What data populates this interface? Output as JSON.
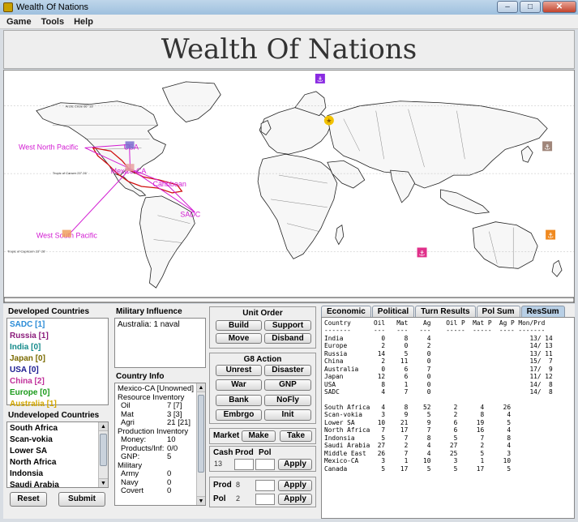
{
  "window": {
    "title": "Wealth Of Nations",
    "minimize": "–",
    "maximize": "□",
    "close": "✕"
  },
  "menu": [
    "Game",
    "Tools",
    "Help"
  ],
  "header": {
    "title": "Wealth Of Nations"
  },
  "map": {
    "labels": {
      "west_north_pacific": "West North Pacific",
      "usa": "USA",
      "mexico_ca": "Mexico-CA",
      "caribbean": "Caribbean",
      "sadc": "SADC",
      "west_south_pacific": "West South Pacific"
    },
    "latitude_lines": {
      "arctic": "Arctic Circle 66° 33'",
      "cancer": "Tropic of Cancer 23° 26'",
      "capricorn": "Tropic of Capricorn 23° 26'"
    },
    "icons": [
      "anchor-purple",
      "star-gold",
      "anchor-brown",
      "anchor-pink",
      "anchor-orange",
      "ship-usa",
      "ship-mexico",
      "ship-wsp"
    ],
    "route_color": "#d21bd2"
  },
  "developed": {
    "title": "Developed Countries",
    "items": [
      {
        "label": "SADC [1]",
        "color": "#2a8bd6"
      },
      {
        "label": "Russia [1]",
        "color": "#8a1a7a"
      },
      {
        "label": "India [0]",
        "color": "#138a8a"
      },
      {
        "label": "Japan [0]",
        "color": "#7a6a00"
      },
      {
        "label": "USA [0]",
        "color": "#1a1a90"
      },
      {
        "label": "China [2]",
        "color": "#c0309a"
      },
      {
        "label": "Europe [0]",
        "color": "#1a9a1a"
      },
      {
        "label": "Australia [1]",
        "color": "#d4a800"
      }
    ]
  },
  "undeveloped": {
    "title": "Undeveloped Countries",
    "items": [
      "South Africa",
      "Scan-vokia",
      "Lower SA",
      "North Africa",
      "Indonsia",
      "Saudi Arabia"
    ],
    "scroll_up": "▲",
    "scroll_down": "▼"
  },
  "buttons": {
    "reset": "Reset",
    "submit": "Submit"
  },
  "military_influence": {
    "title": "Military Influence",
    "text": "Australia: 1 naval"
  },
  "country_info": {
    "title": "Country Info",
    "rows": [
      {
        "label": "Mexico-CA [Unowned]",
        "value": "",
        "indent": false
      },
      {
        "label": "Resource Inventory",
        "value": "",
        "indent": false
      },
      {
        "label": "Oil",
        "value": "7 [7]",
        "indent": true
      },
      {
        "label": "Mat",
        "value": "3 [3]",
        "indent": true
      },
      {
        "label": "Agri",
        "value": "21 [21]",
        "indent": true
      },
      {
        "label": "Production Inventory",
        "value": "",
        "indent": false
      },
      {
        "label": "Money:",
        "value": "10",
        "indent": true
      },
      {
        "label": "Products/Inf:",
        "value": "0/0",
        "indent": true
      },
      {
        "label": "GNP:",
        "value": "5",
        "indent": true
      },
      {
        "label": "Military",
        "value": "",
        "indent": false
      },
      {
        "label": "Army",
        "value": "0",
        "indent": true
      },
      {
        "label": "Navy",
        "value": "0",
        "indent": true
      },
      {
        "label": "Covert",
        "value": "0",
        "indent": true
      }
    ]
  },
  "unit_order": {
    "title": "Unit Order",
    "build": "Build",
    "support": "Support",
    "move": "Move",
    "disband": "Disband"
  },
  "g8": {
    "title": "G8 Action",
    "unrest": "Unrest",
    "disaster": "Disaster",
    "war": "War",
    "gnp": "GNP",
    "bank": "Bank",
    "nofly": "NoFly",
    "embrgo": "Embrgo",
    "init": "Init"
  },
  "market": {
    "label": "Market",
    "make": "Make",
    "take": "Take"
  },
  "cash_prod_pol": {
    "cash": "Cash",
    "prod": "Prod",
    "pol": "Pol",
    "cash_value": "13",
    "apply": "Apply"
  },
  "prod_pol": {
    "prod": "Prod",
    "prod_value": "8",
    "pol": "Pol",
    "pol_value": "2",
    "apply": "Apply"
  },
  "tabs": [
    "Economic",
    "Political",
    "Turn Results",
    "Pol Sum",
    "ResSum"
  ],
  "ressum": {
    "text": "Country      Oil   Mat    Ag    Oil P  Mat P  Ag P Mon/Prd\n-------      ---   ---   ---    -----  -----  ---- -------\nIndia          0     8     4                          13/ 14\nEurope         2     0     2                          14/ 13\nRussia        14     5     0                          13/ 11\nChina          2    11     0                          15/  7\nAustralia      0     6     7                          17/  9\nJapan         12     6     0                          11/ 12\nUSA            8     1     0                          14/  8\nSADC           4     7     0                          14/  8\n\nSouth Africa   4     8    52      2      4     26\nScan-vokia     3     9     5      2      8      4\nLower SA      10    21     9      6     19      5\nNorth Africa   7    17     7      6     16      4\nIndonsia       5     7     8      5      7      8\nSaudi Arabia  27     2     4     27      2      4\nMiddle East   26     7     4     25      5      3\nMexico-CA      3     1    10      3      1     10\nCanada         5    17     5      5     17      5"
  }
}
